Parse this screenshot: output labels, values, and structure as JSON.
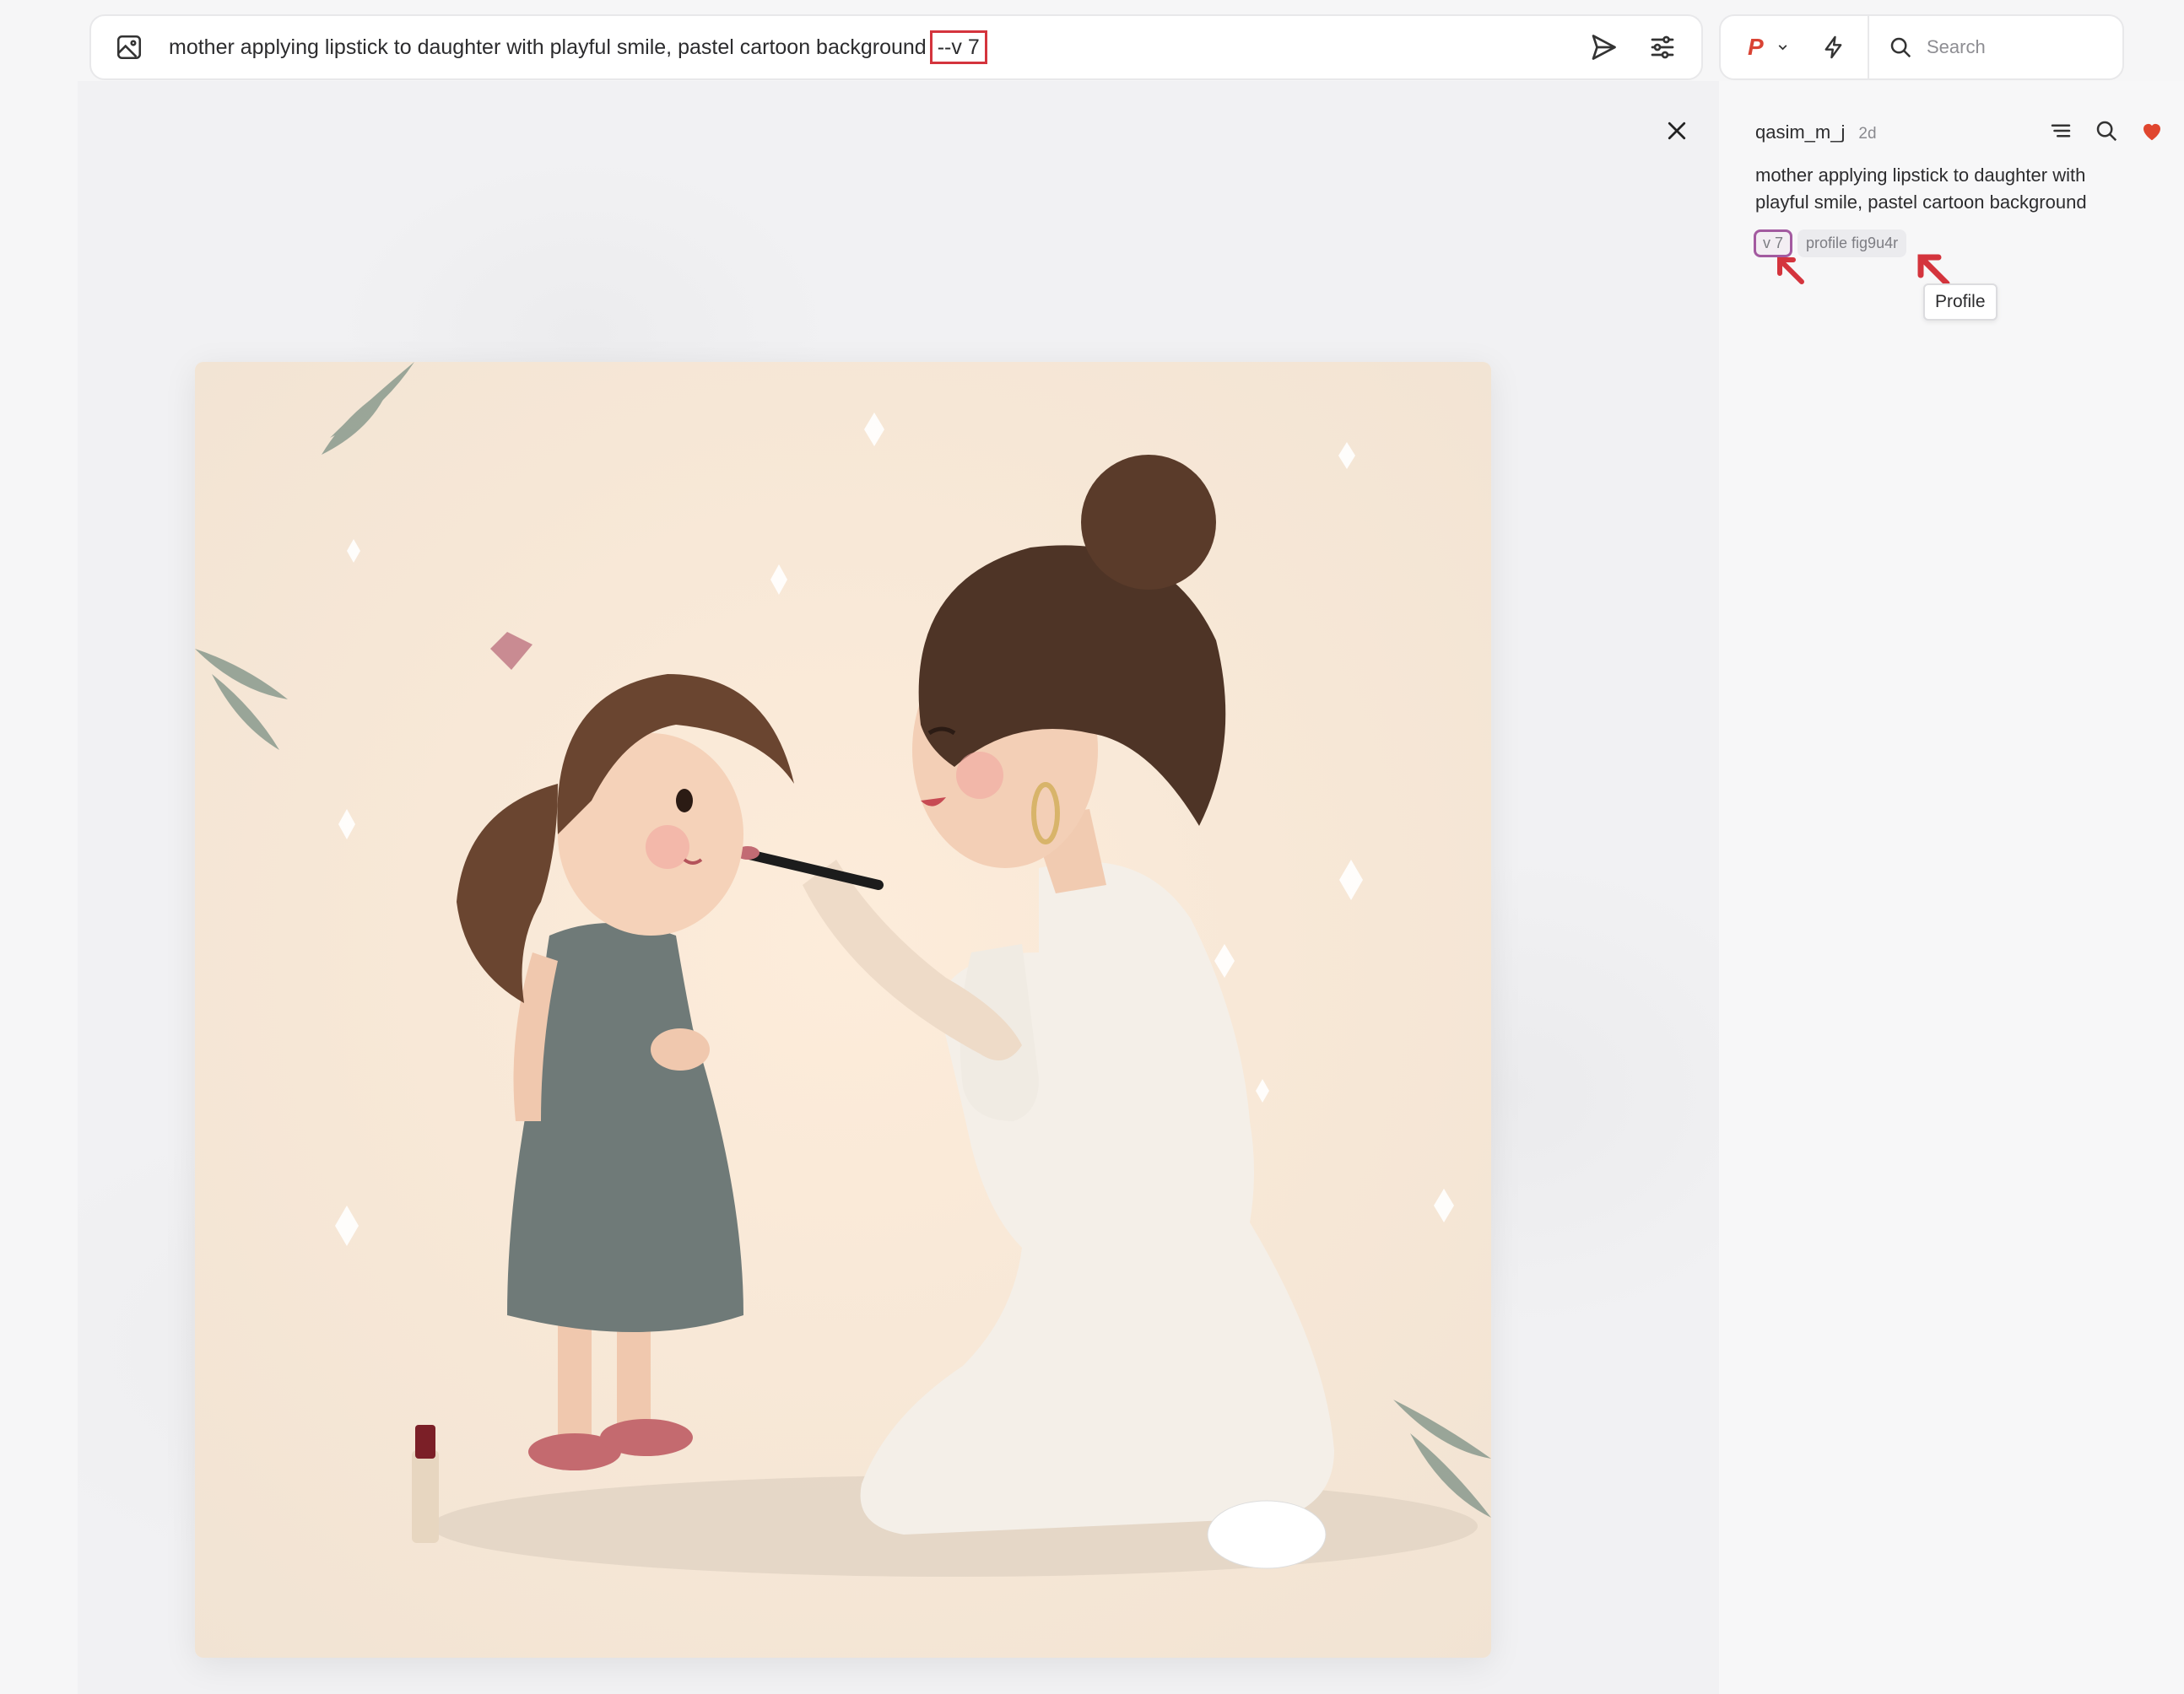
{
  "prompt_bar": {
    "text": "mother applying lipstick to daughter with playful smile, pastel cartoon background",
    "param": "--v 7"
  },
  "toolbar": {
    "mode_letter": "P",
    "search_placeholder": "Search"
  },
  "detail": {
    "username": "qasim_m_j",
    "age": "2d",
    "prompt": "mother applying lipstick to daughter with playful smile, pastel cartoon background",
    "tags": {
      "version": "v 7",
      "profile": "profile fig9u4r"
    },
    "tooltip": "Profile"
  },
  "colors": {
    "accent_red": "#d4343d",
    "heart": "#e0462f",
    "version_tag_border": "#a35aa0",
    "image_bg": "#fbe9d8"
  },
  "icons": [
    "image-icon",
    "send-icon",
    "sliders-icon",
    "chevron-down-icon",
    "bolt-icon",
    "search-icon",
    "close-icon",
    "list-icon",
    "heart-icon"
  ]
}
